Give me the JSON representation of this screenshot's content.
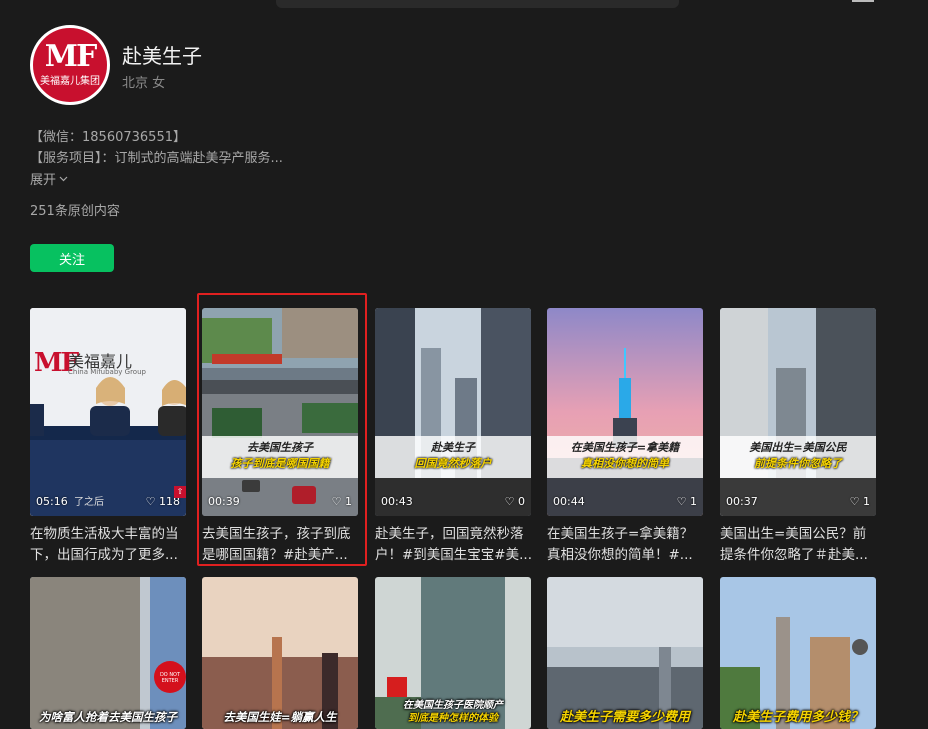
{
  "profile": {
    "name": "赴美生子",
    "location_gender": "北京 女",
    "avatar_brand_cn": "美福嘉儿集团",
    "avatar_logo": "MF",
    "bio_wechat": "【微信：18560736551】",
    "bio_service": "【服务项目】：订制式的高端赴美孕产服务...",
    "expand_label": "展开",
    "post_count": "251条原创内容",
    "follow_label": "关注"
  },
  "videos_row1": [
    {
      "caption_l1": "",
      "caption_l2": "",
      "logo_text": "美福嘉儿",
      "logo_sub": "China Mifubaby Group",
      "duration": "05:16",
      "likes": "118",
      "overlay_text": "了之后",
      "desc_1": "在物质生活极大丰富的当",
      "desc_2": "下，出国行成为了更多..."
    },
    {
      "caption_l1": "去美国生孩子",
      "caption_l2": "孩子到底是哪国国籍",
      "duration": "00:39",
      "likes": "1",
      "desc_1": "去美国生孩子，孩子到底",
      "desc_2": "是哪国国籍？#赴美产..."
    },
    {
      "caption_l1": "赴美生子",
      "caption_l2": "回国竟然秒落户",
      "duration": "00:43",
      "likes": "0",
      "desc_1": "赴美生子，回国竟然秒落",
      "desc_2": "户！#到美国生宝宝#美..."
    },
    {
      "caption_l1": "在美国生孩子=拿美籍",
      "caption_l2": "真相没你想的简单",
      "duration": "00:44",
      "likes": "1",
      "desc_1": "在美国生孩子=拿美籍？",
      "desc_2": "真相没你想的简单！#..."
    },
    {
      "caption_l1": "美国出生=美国公民",
      "caption_l2": "前提条件你忽略了",
      "duration": "00:37",
      "likes": "1",
      "desc_1": "美国出生=美国公民？前",
      "desc_2": "提条件你忽略了＃赴美..."
    }
  ],
  "videos_row2": [
    {
      "caption": "为啥富人抢着去美国生孩子",
      "sign_1": "DO NOT",
      "sign_2": "ENTER"
    },
    {
      "caption": "去美国生娃=躺赢人生"
    },
    {
      "caption_1": "在美国生孩子医院顺产",
      "caption_2": "到底是种怎样的体验"
    },
    {
      "caption": "赴美生子需要多少费用"
    },
    {
      "caption": "赴美生子费用多少钱？"
    }
  ],
  "icons": {
    "heart": "heart-icon",
    "share": "share-icon",
    "chevron": "chevron-down-icon"
  },
  "colors": {
    "accent": "#07c160",
    "highlight": "#e02020",
    "caption_yellow": "#f5d300",
    "bg": "#1b1b1b"
  }
}
